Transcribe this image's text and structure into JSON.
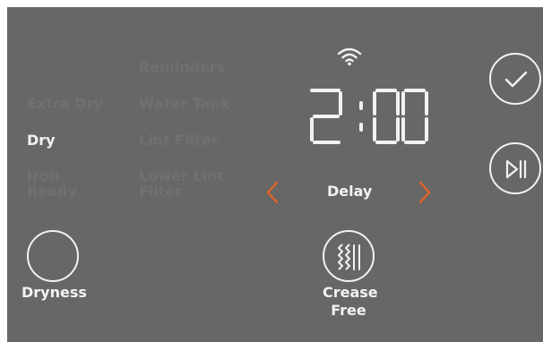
{
  "colors": {
    "panel": "#676767",
    "dim_text": "#707070",
    "lit_text": "#f2f2f2",
    "accent_arrow": "#e2622a"
  },
  "status": {
    "wifi_icon": "wifi-icon"
  },
  "display": {
    "time": "2:00"
  },
  "dryness_options": {
    "extra_dry": "Extra Dry",
    "dry": "Dry",
    "iron_ready_line1": "Iron",
    "iron_ready_line2": "Ready"
  },
  "indicators": {
    "reminders": "Reminders",
    "water_tank": "Water Tank",
    "lint_filter": "Lint Filter",
    "lower_lint_filter_line1": "Lower Lint",
    "lower_lint_filter_line2": "Filter"
  },
  "delay": {
    "label": "Delay",
    "prev_icon": "chevron-left-icon",
    "next_icon": "chevron-right-icon"
  },
  "buttons": {
    "dryness_label": "Dryness",
    "crease_free_line1": "Crease",
    "crease_free_line2": "Free",
    "confirm_icon": "checkmark-icon",
    "start_pause_icon": "play-pause-icon"
  }
}
